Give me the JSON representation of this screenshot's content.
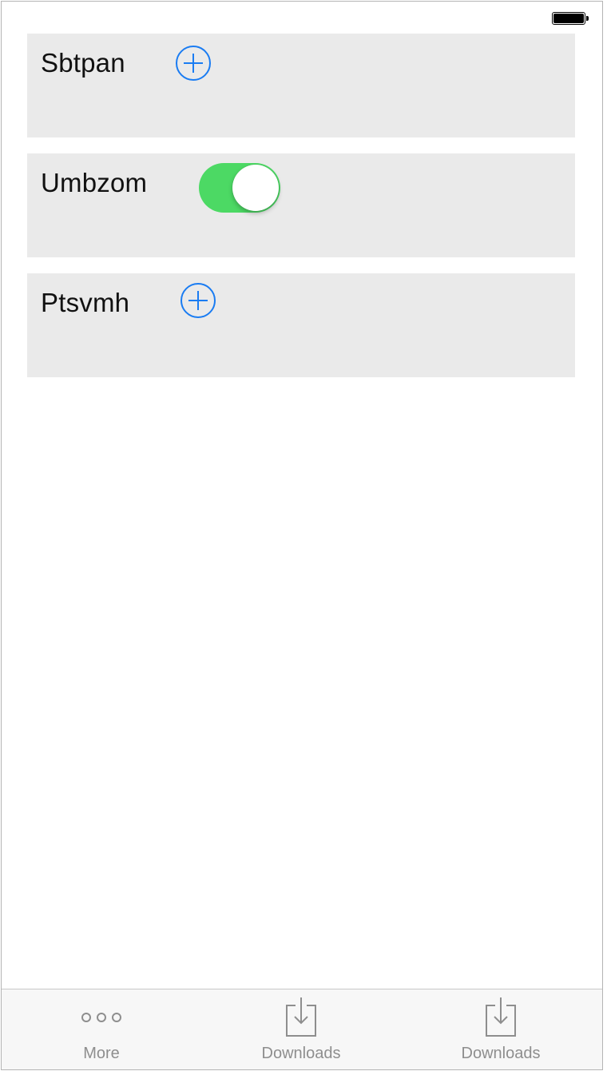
{
  "status_bar": {
    "battery_icon": "battery-full-icon"
  },
  "cards": [
    {
      "label": "Sbtpan",
      "control": "add-button",
      "icon": "plus-circle-icon"
    },
    {
      "label": "Umbzom",
      "control": "toggle",
      "toggle_on": true,
      "toggle_color": "#4cd964"
    },
    {
      "label": "Ptsvmh",
      "control": "add-button",
      "icon": "plus-circle-icon"
    }
  ],
  "tab_bar": {
    "tabs": [
      {
        "label": "More",
        "icon": "more-icon"
      },
      {
        "label": "Downloads",
        "icon": "download-icon"
      },
      {
        "label": "Downloads",
        "icon": "download-icon"
      }
    ]
  },
  "colors": {
    "accent": "#1a7cf2",
    "card_bg": "#eaeaea",
    "tab_label": "#8e8e8e"
  }
}
